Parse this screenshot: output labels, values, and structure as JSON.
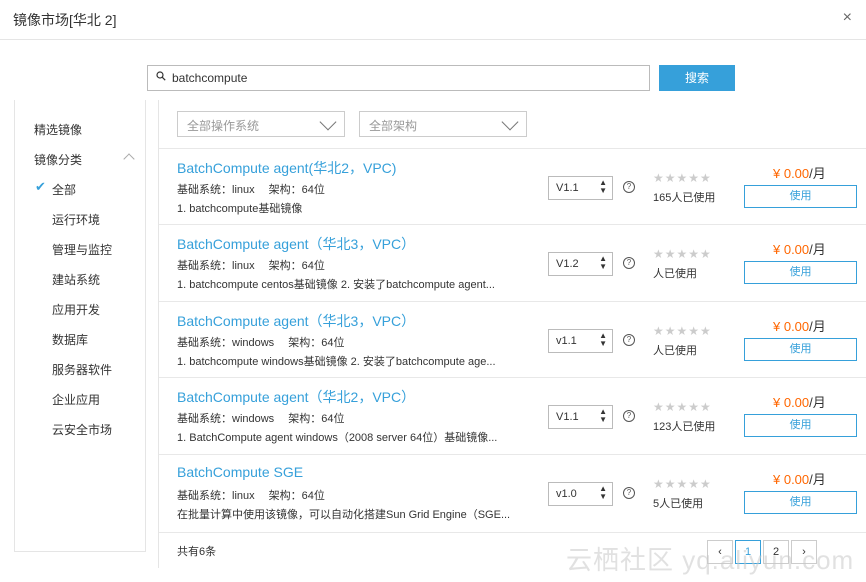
{
  "header": {
    "title": "镜像市场[华北 2]",
    "close": "×"
  },
  "search": {
    "value": "batchcompute",
    "button": "搜索"
  },
  "sidebar": {
    "featured": "精选镜像",
    "category": "镜像分类",
    "checkmark": "✔",
    "items": [
      "全部",
      "运行环境",
      "管理与监控",
      "建站系统",
      "应用开发",
      "数据库",
      "服务器软件",
      "企业应用",
      "云安全市场"
    ]
  },
  "filters": {
    "os": "全部操作系统",
    "arch": "全部架构"
  },
  "rows": [
    {
      "title": "BatchCompute agent(华北2，VPC)",
      "meta": "基础系统：linux　 架构：64位",
      "desc": "1. batchcompute基础镜像",
      "version": "V1.1",
      "users": "165人已使用",
      "price": "¥ 0.00",
      "unit": "/月",
      "btn": "使用"
    },
    {
      "title": "BatchCompute agent（华北3，VPC）",
      "meta": "基础系统：linux　 架构：64位",
      "desc": "1. batchcompute centos基础镜像 2. 安装了batchcompute agent...",
      "version": "V1.2",
      "users": "人已使用",
      "price": "¥ 0.00",
      "unit": "/月",
      "btn": "使用"
    },
    {
      "title": "BatchCompute agent（华北3，VPC）",
      "meta": "基础系统：windows　 架构：64位",
      "desc": "1. batchcompute windows基础镜像 2. 安装了batchcompute age...",
      "version": "v1.1",
      "users": "人已使用",
      "price": "¥ 0.00",
      "unit": "/月",
      "btn": "使用"
    },
    {
      "title": "BatchCompute agent（华北2，VPC）",
      "meta": "基础系统：windows　 架构：64位",
      "desc": "1. BatchCompute agent windows（2008 server 64位）基础镜像...",
      "version": "V1.1",
      "users": "123人已使用",
      "price": "¥ 0.00",
      "unit": "/月",
      "btn": "使用"
    },
    {
      "title": "BatchCompute SGE",
      "meta": "基础系统：linux　 架构：64位",
      "desc": "在批量计算中使用该镜像，可以自动化搭建Sun Grid Engine（SGE...",
      "version": "v1.0",
      "users": "5人已使用",
      "price": "¥ 0.00",
      "unit": "/月",
      "btn": "使用"
    }
  ],
  "rating_stars": "★★★★★",
  "footer": {
    "total": "共有6条",
    "pages": [
      "1",
      "2"
    ],
    "current_page": "1",
    "prev": "‹",
    "next": "›"
  },
  "watermark": "云栖社区 yq.aliyun.com",
  "colors": {
    "accent": "#36a0da",
    "price": "#ff6600"
  }
}
